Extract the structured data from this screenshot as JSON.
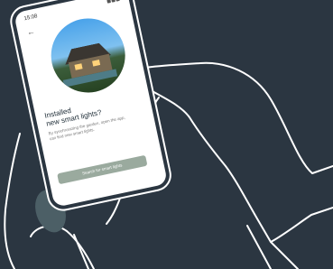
{
  "phone": {
    "status_time": "15:08",
    "title_line1": "Installed",
    "title_line2": "new smart lights?",
    "description": "By synchronizing the garden, open the app, can find new smart lights.",
    "cta_label": "Search for smart lights"
  },
  "colors": {
    "background": "#2b3641",
    "line_art": "#ffffff",
    "screen": "#ffffff",
    "button": "#9aaa9e",
    "thumb_highlight": "#4c5f66"
  },
  "icons": {
    "back": "back-arrow-icon"
  }
}
